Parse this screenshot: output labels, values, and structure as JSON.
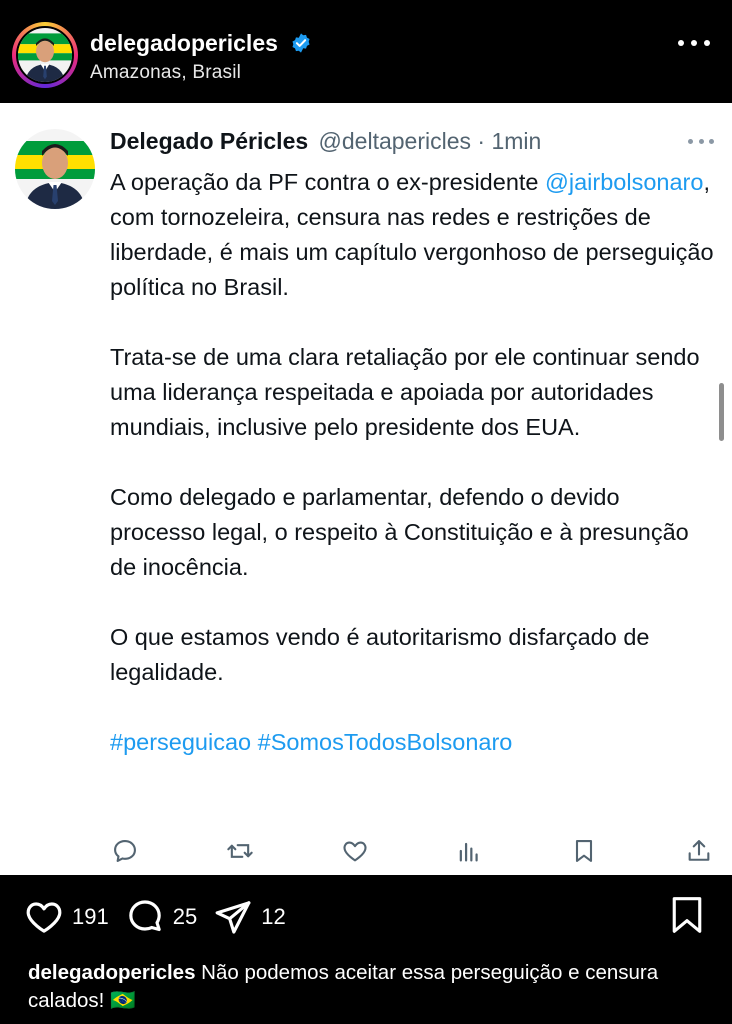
{
  "post_header": {
    "username": "delegadopericles",
    "location": "Amazonas, Brasil",
    "icons": {
      "verified": "verified-badge-icon",
      "more": "more-options-icon"
    },
    "colors": {
      "verified": "#1d9bf0"
    }
  },
  "tweet": {
    "display_name": "Delegado Péricles",
    "handle": "@deltapericles",
    "separator": "·",
    "time": "1min",
    "paragraph1_before": "A operação da PF contra o ex-presidente ",
    "paragraph1_mention": "@jairbolsonaro",
    "paragraph1_after": ", com tornozeleira, censura nas redes e restrições de liberdade, é mais um capítulo vergonhoso de perseguição política no Brasil.",
    "paragraph2": "Trata-se de uma clara retaliação por ele continuar sendo uma liderança respeitada e apoiada por autoridades mundiais, inclusive pelo presidente dos EUA.",
    "paragraph3": "Como delegado e parlamentar, defendo o devido processo legal, o respeito à Constituição e à presunção de inocência.",
    "paragraph4": "O que estamos vendo é autoritarismo disfarçado de legalidade.",
    "hashtag1": "#perseguicao",
    "hashtag2": "#SomosTodosBolsonaro",
    "actions": [
      "reply-icon",
      "retweet-icon",
      "like-icon",
      "views-icon",
      "bookmark-icon",
      "share-icon"
    ],
    "colors": {
      "link": "#1d9bf0",
      "muted": "#536471"
    }
  },
  "engagement": {
    "likes": "191",
    "comments": "25",
    "shares": "12",
    "icons": [
      "heart-icon",
      "comment-icon",
      "send-icon",
      "save-icon"
    ]
  },
  "caption": {
    "username": "delegadopericles",
    "text": " Não podemos aceitar essa perseguição e censura calados! ",
    "emoji": "🇧🇷"
  }
}
